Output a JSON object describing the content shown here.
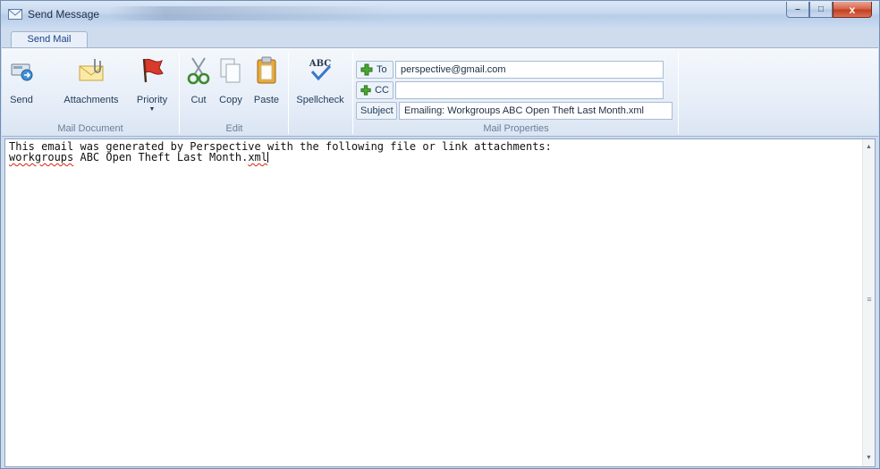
{
  "window": {
    "title": "Send Message",
    "controls": {
      "minimize": "–",
      "maximize": "□",
      "close": "x"
    }
  },
  "ribbon": {
    "tabs": [
      {
        "label": "Send Mail",
        "active": true
      }
    ],
    "groups": {
      "mail_document": {
        "label": "Mail Document",
        "buttons": {
          "send": "Send",
          "attachments": "Attachments",
          "priority": "Priority"
        }
      },
      "edit": {
        "label": "Edit",
        "buttons": {
          "cut": "Cut",
          "copy": "Copy",
          "paste": "Paste",
          "spellcheck": "Spellcheck"
        },
        "spellcheck_icon_text": "ABC"
      },
      "mail_properties": {
        "label": "Mail Properties",
        "to": {
          "label": "To",
          "value": "perspective@gmail.com"
        },
        "cc": {
          "label": "CC",
          "value": ""
        },
        "subject": {
          "label": "Subject",
          "value": "Emailing: Workgroups ABC Open Theft Last Month.xml"
        }
      }
    }
  },
  "editor": {
    "line1": "This email was generated by Perspective with the following file or link attachments:",
    "line2_word1": "workgroups",
    "line2_middle": " ABC Open Theft Last Month.",
    "line2_word2": "xml"
  },
  "scrollbar": {
    "up": "▲",
    "down": "▼",
    "grip": "≡"
  },
  "colors": {
    "accent": "#15428b",
    "frame": "#6f8fb3",
    "close": "#c3401f",
    "spell_underline": "#d21"
  },
  "icons": [
    "envelope-icon",
    "send-icon",
    "attachment-icon",
    "flag-icon",
    "scissors-icon",
    "copy-icon",
    "paste-icon",
    "spellcheck-icon",
    "plus-icon"
  ]
}
